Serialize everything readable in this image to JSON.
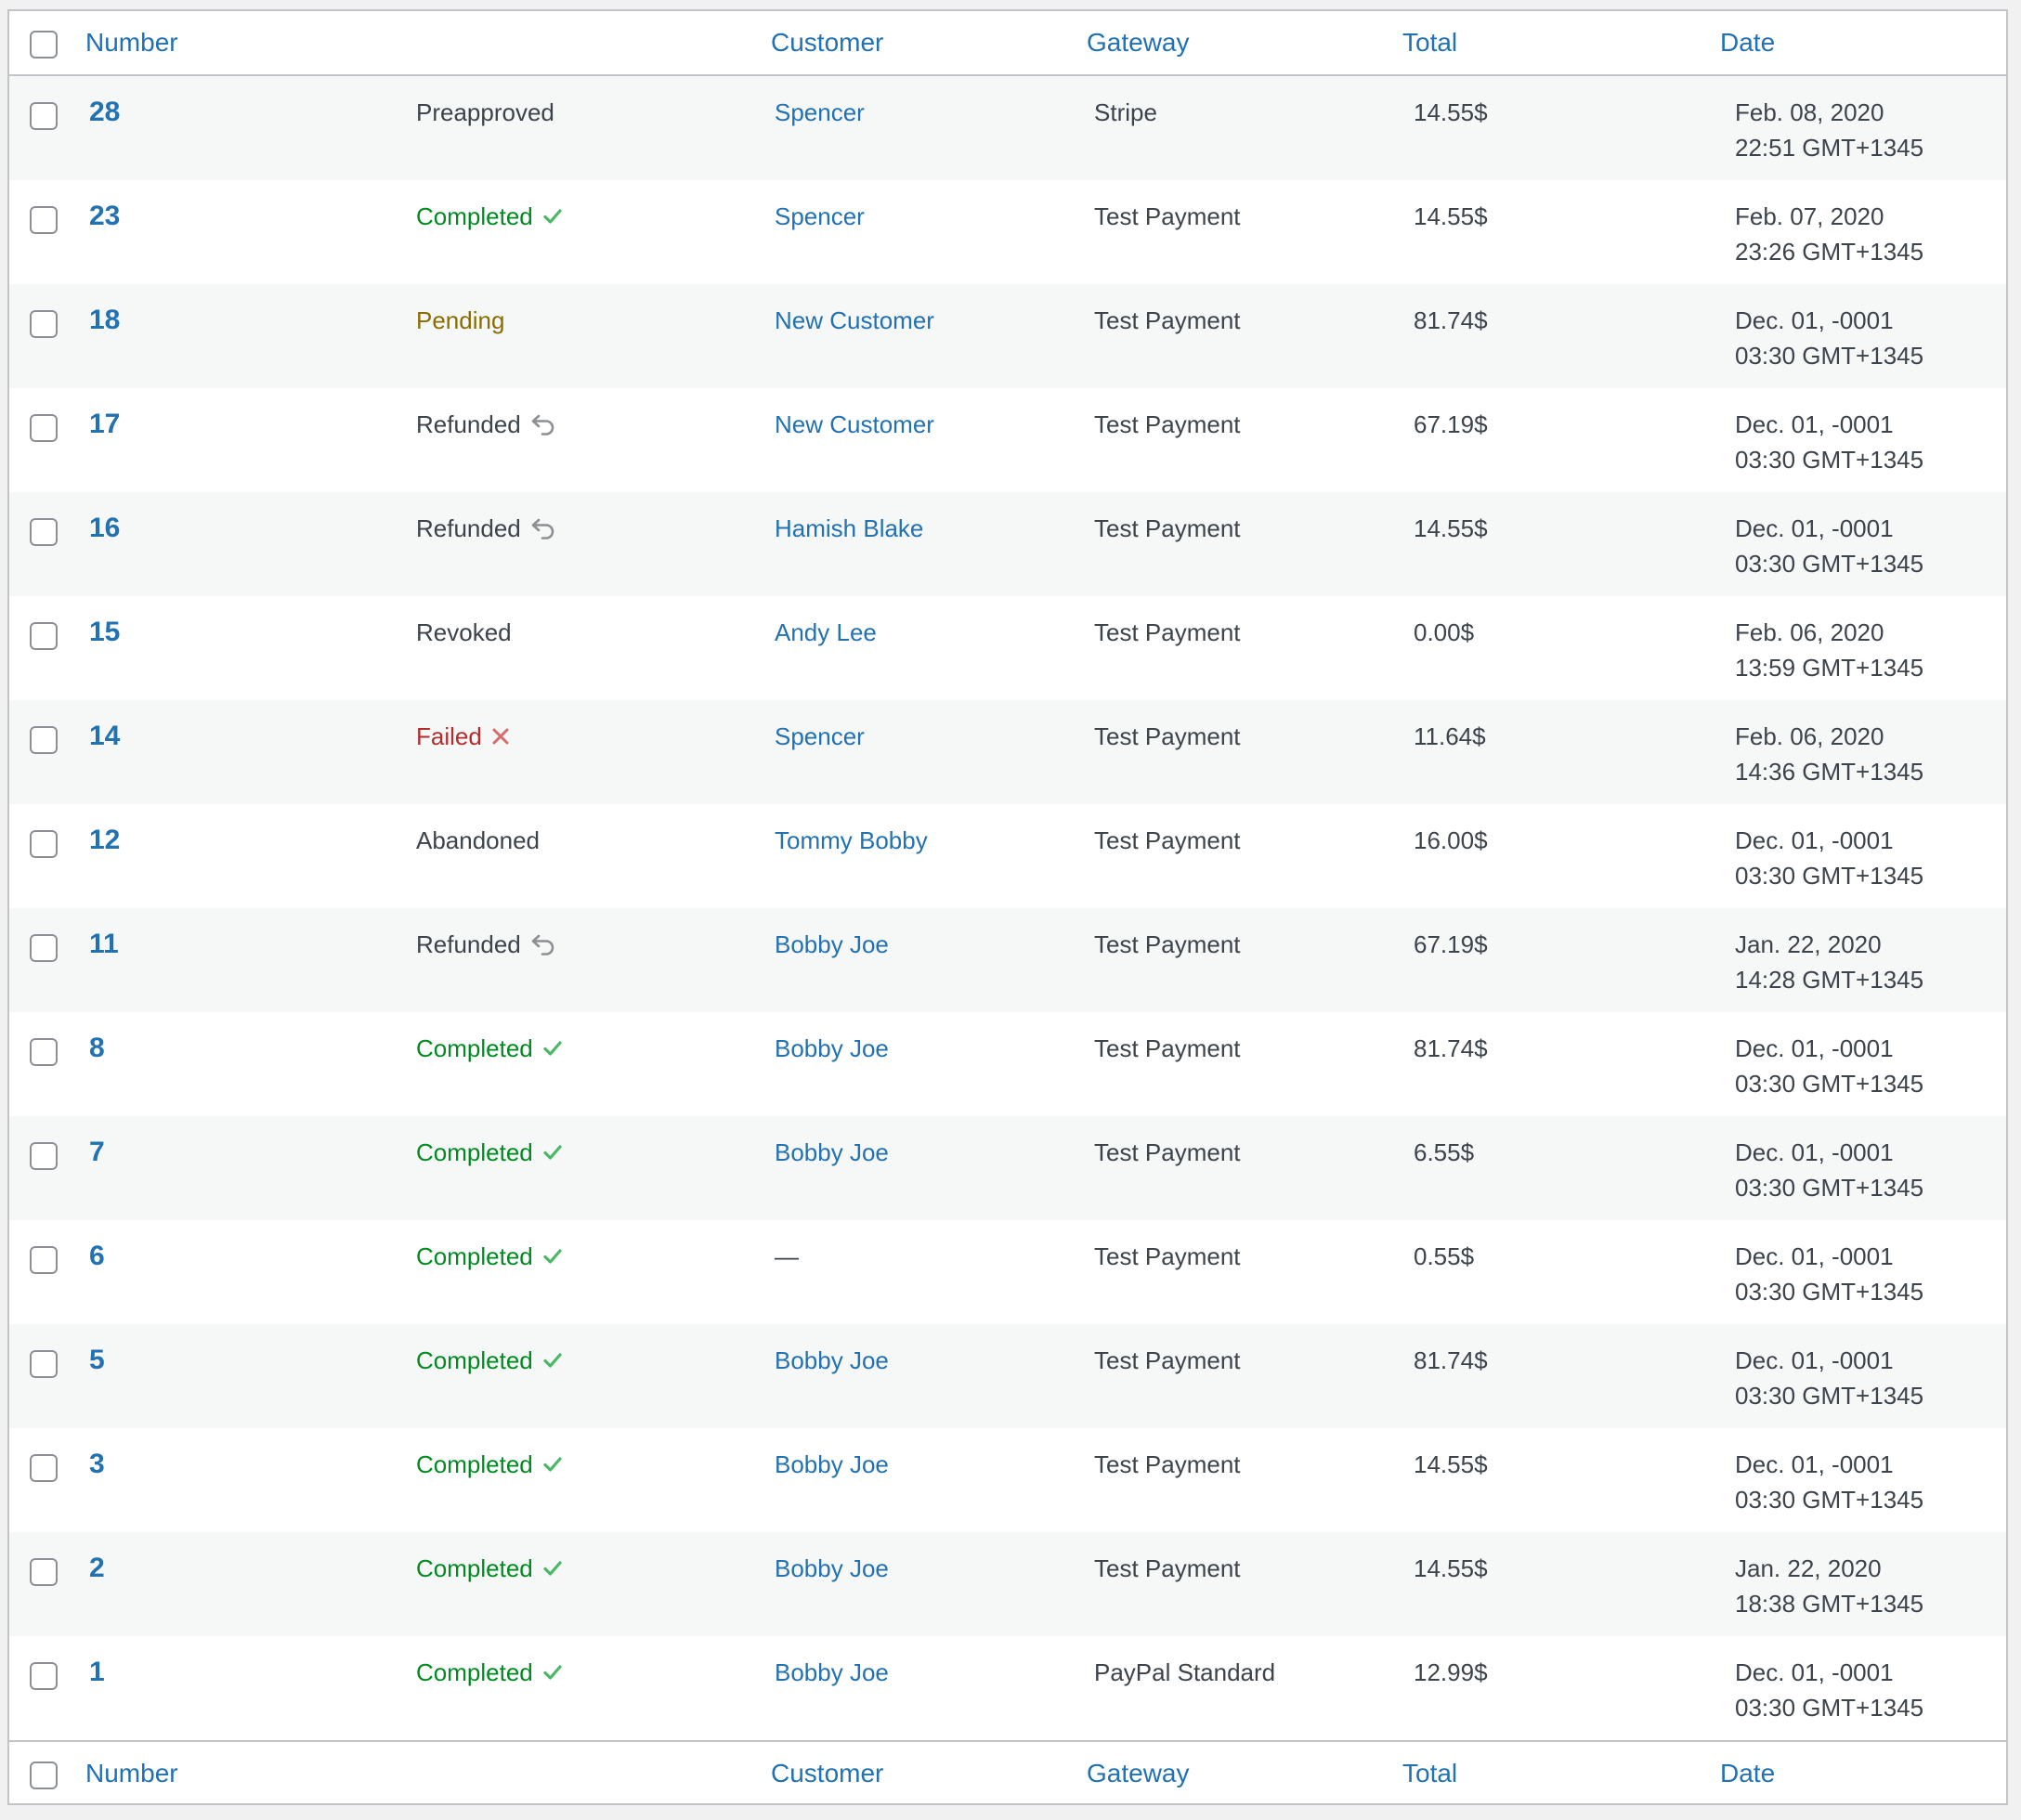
{
  "header": {
    "number": "Number",
    "customer": "Customer",
    "gateway": "Gateway",
    "total": "Total",
    "date": "Date"
  },
  "colors": {
    "link": "#2271b1",
    "completed": "#008a20",
    "pending": "#8a6d00",
    "failed": "#b32d2e",
    "text": "#3c434a"
  },
  "rows": [
    {
      "number": "28",
      "status": "Preapproved",
      "status_type": "neutral",
      "status_icon": "",
      "customer": "Spencer",
      "gateway": "Stripe",
      "total": "14.55$",
      "date1": "Feb. 08, 2020",
      "date2": "22:51 GMT+1345"
    },
    {
      "number": "23",
      "status": "Completed",
      "status_type": "completed",
      "status_icon": "check-icon",
      "customer": "Spencer",
      "gateway": "Test Payment",
      "total": "14.55$",
      "date1": "Feb. 07, 2020",
      "date2": "23:26 GMT+1345"
    },
    {
      "number": "18",
      "status": "Pending",
      "status_type": "pending",
      "status_icon": "",
      "customer": "New Customer",
      "gateway": "Test Payment",
      "total": "81.74$",
      "date1": "Dec. 01, -0001",
      "date2": "03:30 GMT+1345"
    },
    {
      "number": "17",
      "status": "Refunded",
      "status_type": "neutral",
      "status_icon": "undo-icon",
      "customer": "New Customer",
      "gateway": "Test Payment",
      "total": "67.19$",
      "date1": "Dec. 01, -0001",
      "date2": "03:30 GMT+1345"
    },
    {
      "number": "16",
      "status": "Refunded",
      "status_type": "neutral",
      "status_icon": "undo-icon",
      "customer": "Hamish Blake",
      "gateway": "Test Payment",
      "total": "14.55$",
      "date1": "Dec. 01, -0001",
      "date2": "03:30 GMT+1345"
    },
    {
      "number": "15",
      "status": "Revoked",
      "status_type": "neutral",
      "status_icon": "",
      "customer": "Andy Lee",
      "gateway": "Test Payment",
      "total": "0.00$",
      "date1": "Feb. 06, 2020",
      "date2": "13:59 GMT+1345"
    },
    {
      "number": "14",
      "status": "Failed",
      "status_type": "failed",
      "status_icon": "x-icon",
      "customer": "Spencer",
      "gateway": "Test Payment",
      "total": "11.64$",
      "date1": "Feb. 06, 2020",
      "date2": "14:36 GMT+1345"
    },
    {
      "number": "12",
      "status": "Abandoned",
      "status_type": "neutral",
      "status_icon": "",
      "customer": "Tommy Bobby",
      "gateway": "Test Payment",
      "total": "16.00$",
      "date1": "Dec. 01, -0001",
      "date2": "03:30 GMT+1345"
    },
    {
      "number": "11",
      "status": "Refunded",
      "status_type": "neutral",
      "status_icon": "undo-icon",
      "customer": "Bobby Joe",
      "gateway": "Test Payment",
      "total": "67.19$",
      "date1": "Jan. 22, 2020",
      "date2": "14:28 GMT+1345"
    },
    {
      "number": "8",
      "status": "Completed",
      "status_type": "completed",
      "status_icon": "check-icon",
      "customer": "Bobby Joe",
      "gateway": "Test Payment",
      "total": "81.74$",
      "date1": "Dec. 01, -0001",
      "date2": "03:30 GMT+1345"
    },
    {
      "number": "7",
      "status": "Completed",
      "status_type": "completed",
      "status_icon": "check-icon",
      "customer": "Bobby Joe",
      "gateway": "Test Payment",
      "total": "6.55$",
      "date1": "Dec. 01, -0001",
      "date2": "03:30 GMT+1345"
    },
    {
      "number": "6",
      "status": "Completed",
      "status_type": "completed",
      "status_icon": "check-icon",
      "customer": "—",
      "gateway": "Test Payment",
      "total": "0.55$",
      "date1": "Dec. 01, -0001",
      "date2": "03:30 GMT+1345"
    },
    {
      "number": "5",
      "status": "Completed",
      "status_type": "completed",
      "status_icon": "check-icon",
      "customer": "Bobby Joe",
      "gateway": "Test Payment",
      "total": "81.74$",
      "date1": "Dec. 01, -0001",
      "date2": "03:30 GMT+1345"
    },
    {
      "number": "3",
      "status": "Completed",
      "status_type": "completed",
      "status_icon": "check-icon",
      "customer": "Bobby Joe",
      "gateway": "Test Payment",
      "total": "14.55$",
      "date1": "Dec. 01, -0001",
      "date2": "03:30 GMT+1345"
    },
    {
      "number": "2",
      "status": "Completed",
      "status_type": "completed",
      "status_icon": "check-icon",
      "customer": "Bobby Joe",
      "gateway": "Test Payment",
      "total": "14.55$",
      "date1": "Jan. 22, 2020",
      "date2": "18:38 GMT+1345"
    },
    {
      "number": "1",
      "status": "Completed",
      "status_type": "completed",
      "status_icon": "check-icon",
      "customer": "Bobby Joe",
      "gateway": "PayPal Standard",
      "total": "12.99$",
      "date1": "Dec. 01, -0001",
      "date2": "03:30 GMT+1345"
    }
  ]
}
